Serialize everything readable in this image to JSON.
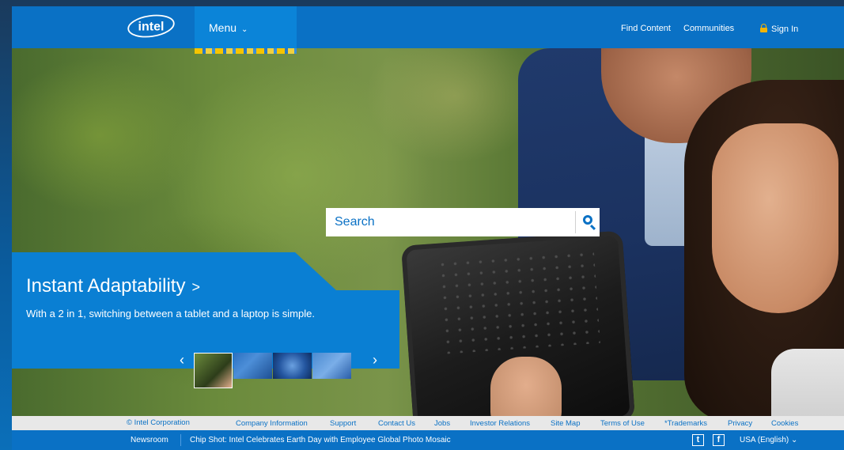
{
  "header": {
    "logo_text": "intel",
    "menu_label": "Menu",
    "find_content": "Find Content",
    "communities": "Communities",
    "sign_in": "Sign In"
  },
  "search": {
    "placeholder": "Search"
  },
  "promo": {
    "title": "Instant Adaptability",
    "title_arrow": ">",
    "subtitle": "With a 2 in 1, switching between a tablet and a laptop is simple.",
    "prev": "‹",
    "next": "›",
    "thumbnails": 4,
    "active_thumbnail": 1
  },
  "footer": {
    "copyright": "© Intel Corporation",
    "links": [
      "Company Information",
      "Support",
      "Contact Us",
      "Jobs",
      "Investor Relations",
      "Site Map",
      "Terms of Use",
      "*Trademarks",
      "Privacy",
      "Cookies"
    ]
  },
  "newsbar": {
    "newsroom": "Newsroom",
    "headline": "Chip Shot: Intel Celebrates Earth Day with Employee Global Photo Mosaic",
    "twitter": "t",
    "facebook": "f",
    "locale": "USA (English)",
    "locale_chevron": "⌄"
  },
  "colors": {
    "brand_blue": "#0a71c5",
    "promo_blue": "#0a7fd3",
    "accent_yellow": "#f5b400"
  }
}
